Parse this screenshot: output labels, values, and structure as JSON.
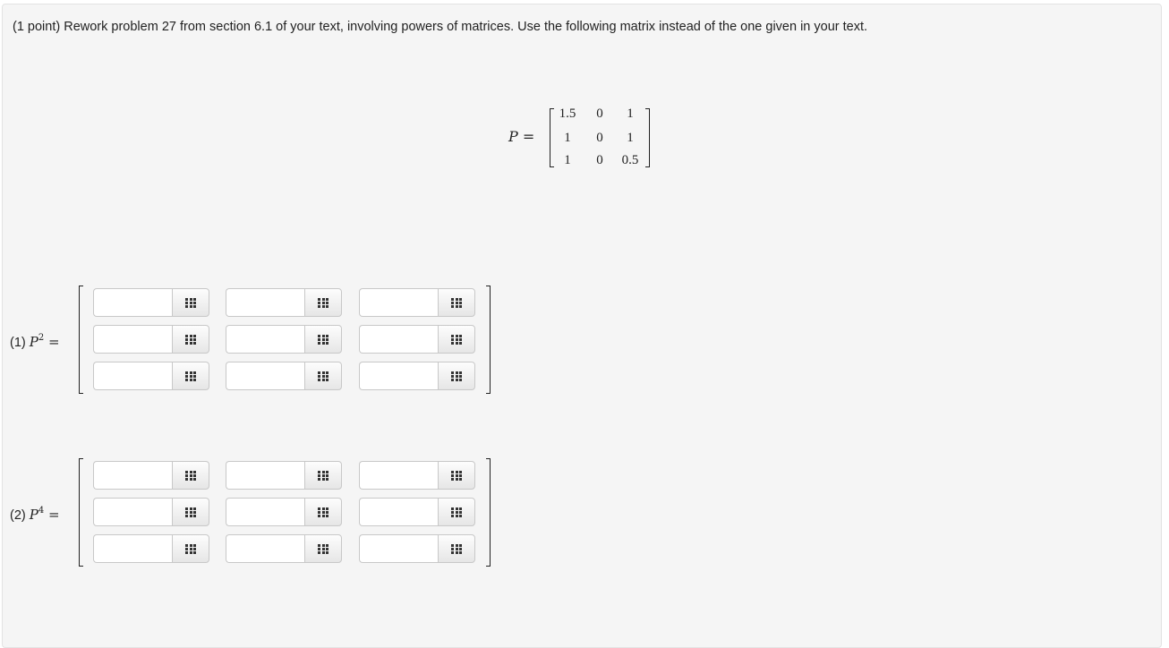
{
  "problem": {
    "statement": "(1 point) Rework problem 27 from section 6.1 of your text, involving powers of matrices. Use the following matrix instead of the one given in your text.",
    "matrix": {
      "name": "P",
      "equals": "=",
      "rows": [
        [
          "1.5",
          "0",
          "1"
        ],
        [
          "1",
          "0",
          "1"
        ],
        [
          "1",
          "0",
          "0.5"
        ]
      ]
    }
  },
  "answers": [
    {
      "prefix": "(1)",
      "base": "P",
      "exponent": "2",
      "equals": "=",
      "cells": [
        [
          "",
          "",
          ""
        ],
        [
          "",
          "",
          ""
        ],
        [
          "",
          "",
          ""
        ]
      ],
      "button_icon": "matrix-grid-icon"
    },
    {
      "prefix": "(2)",
      "base": "P",
      "exponent": "4",
      "equals": "=",
      "cells": [
        [
          "",
          "",
          ""
        ],
        [
          "",
          "",
          ""
        ],
        [
          "",
          "",
          ""
        ]
      ],
      "button_icon": "matrix-grid-icon"
    }
  ]
}
